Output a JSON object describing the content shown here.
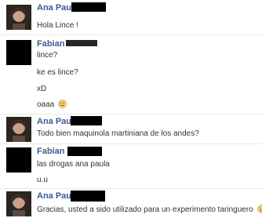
{
  "messages": [
    {
      "sender": "Ana Paula",
      "lines": [
        "Hola Lince !"
      ]
    },
    {
      "sender": "Fabian",
      "lines": [
        "lince?",
        "ke es lince?",
        "xD",
        "oaaa"
      ],
      "emoji_after_last": "smile-icon"
    },
    {
      "sender": "Ana Paula",
      "lines": [
        "Todo bien maquinola martiniana de los andes?"
      ]
    },
    {
      "sender": "Fabian",
      "lines": [
        "las drogas ana paula",
        "u.u"
      ]
    },
    {
      "sender": "Ana Paula",
      "lines": [
        "Gracias, usted a sido utilizado para un experimento taringuero"
      ],
      "emoji_after_last": "smile-icon"
    }
  ],
  "colors": {
    "name": "#3b5998",
    "text": "#333333",
    "divider": "#e9e9e9",
    "emoji_face": "#f7d774",
    "emoji_outline": "#c8a03c"
  }
}
